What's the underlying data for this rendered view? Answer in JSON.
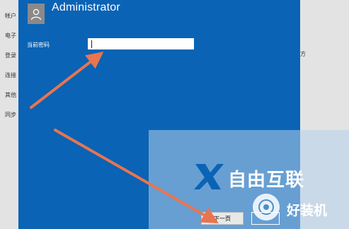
{
  "background": {
    "items": [
      "帐户",
      "电子",
      "登录",
      "连接",
      "其他",
      "同步"
    ],
    "side_text": "方"
  },
  "dialog": {
    "title": "Administrator",
    "avatar_icon": "user-icon",
    "field_label": "当前密码",
    "password_value": "",
    "buttons": {
      "next_label": "下一页",
      "cancel_label": ""
    }
  },
  "watermarks": {
    "brand1": "自由互联",
    "brand2": "好装机"
  },
  "colors": {
    "dialog_bg": "#0a63b5",
    "arrow": "#e8754f"
  }
}
